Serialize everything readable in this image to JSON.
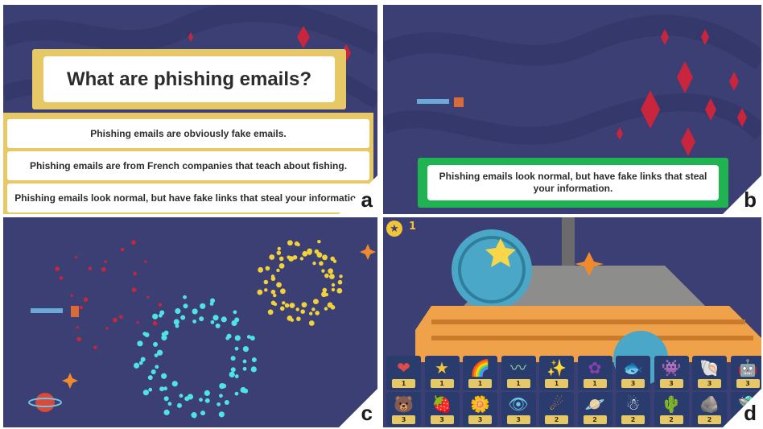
{
  "panels": {
    "a": {
      "label": "a",
      "question": "What are phishing emails?",
      "answers": [
        "Phishing emails are obviously fake emails.",
        "Phishing emails are from French companies that teach about fishing.",
        "Phishing emails look normal, but have fake links that steal your information"
      ]
    },
    "b": {
      "label": "b",
      "correct_answer": "Phishing emails look normal, but have fake links that steal your information."
    },
    "c": {
      "label": "c"
    },
    "d": {
      "label": "d",
      "star_count": "1",
      "stickers": [
        {
          "icon": "heart-icon",
          "glyph": "❤",
          "color": "#e04a4a",
          "count": "1"
        },
        {
          "icon": "star-icon",
          "glyph": "★",
          "color": "#f2c43a",
          "count": "1"
        },
        {
          "icon": "rainbow-icon",
          "glyph": "🌈",
          "color": "#ffffff",
          "count": "1"
        },
        {
          "icon": "mustache-icon",
          "glyph": "〰",
          "color": "#8fd19e",
          "count": "1"
        },
        {
          "icon": "sparkles-icon",
          "glyph": "✨",
          "color": "#f7e07a",
          "count": "1"
        },
        {
          "icon": "flower-icon",
          "glyph": "✿",
          "color": "#8a3fb0",
          "count": "1"
        },
        {
          "icon": "fish-icon",
          "glyph": "🐟",
          "color": "#e04a4a",
          "count": "3"
        },
        {
          "icon": "alien-icon",
          "glyph": "👾",
          "color": "#b38ae0",
          "count": "3"
        },
        {
          "icon": "shell-icon",
          "glyph": "🐚",
          "color": "#f0a7c0",
          "count": "3"
        },
        {
          "icon": "robot-icon",
          "glyph": "🤖",
          "color": "#b0b8d8",
          "count": "3"
        },
        {
          "icon": "bear-icon",
          "glyph": "🐻",
          "color": "#ffffff",
          "count": "3"
        },
        {
          "icon": "strawberry-icon",
          "glyph": "🍓",
          "color": "#e04a4a",
          "count": "3"
        },
        {
          "icon": "sunflower-icon",
          "glyph": "🌼",
          "color": "#f2c43a",
          "count": "3"
        },
        {
          "icon": "eye-ball-icon",
          "glyph": "👁",
          "color": "#6ec6e6",
          "count": "3"
        },
        {
          "icon": "comet-icon",
          "glyph": "☄",
          "color": "#f08a2a",
          "count": "2"
        },
        {
          "icon": "planet-icon",
          "glyph": "🪐",
          "color": "#4a7ad0",
          "count": "2"
        },
        {
          "icon": "snowman-icon",
          "glyph": "☃",
          "color": "#ffffff",
          "count": "2"
        },
        {
          "icon": "cactus-icon",
          "glyph": "🌵",
          "color": "#5bbf5b",
          "count": "2"
        },
        {
          "icon": "rock-icon",
          "glyph": "🪨",
          "color": "#d9c7a0",
          "count": "2"
        },
        {
          "icon": "ufo-icon",
          "glyph": "🛸",
          "color": "#8fd19e",
          "count": "2"
        }
      ]
    }
  },
  "colors": {
    "space_bg": "#3b3f73",
    "question_frame": "#e6c866",
    "correct_green": "#1fb451",
    "sticker_tile": "#2a3c6d"
  }
}
